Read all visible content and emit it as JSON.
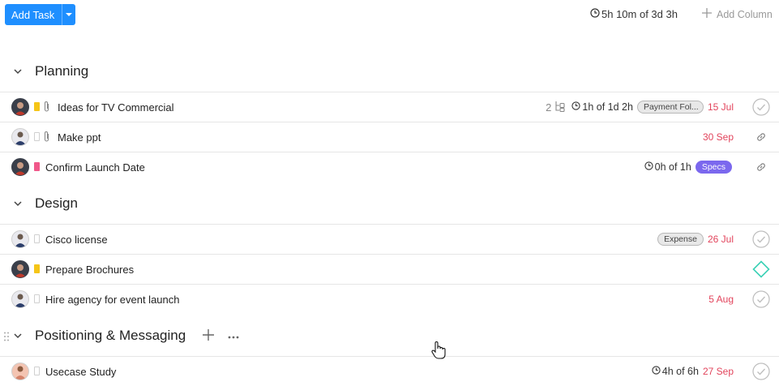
{
  "toolbar": {
    "add_task_label": "Add Task",
    "time_total": "5h 10m of 3d 3h",
    "add_column_label": "Add Column"
  },
  "sections": [
    {
      "title": "Planning",
      "tasks": [
        {
          "name": "Ideas for TV Commercial",
          "priority": "yellow",
          "attachment": true,
          "subtasks": "2",
          "estimate": "1h of 1d 2h",
          "tag": "Payment Fol...",
          "date": "15 Jul",
          "status": "check"
        },
        {
          "name": "Make ppt",
          "priority": "none",
          "attachment": true,
          "date": "30 Sep",
          "status": "link"
        },
        {
          "name": "Confirm Launch Date",
          "priority": "pink",
          "estimate": "0h of 1h",
          "tag": "Specs",
          "status": "link"
        }
      ]
    },
    {
      "title": "Design",
      "tasks": [
        {
          "name": "Cisco license",
          "priority": "none",
          "tag": "Expense",
          "date": "26 Jul",
          "status": "check"
        },
        {
          "name": "Prepare Brochures",
          "priority": "yellow",
          "status": "diamond"
        },
        {
          "name": "Hire agency for event launch",
          "priority": "none",
          "date": "5 Aug",
          "status": "check"
        }
      ]
    },
    {
      "title": "Positioning & Messaging",
      "tasks": [
        {
          "name": "Usecase Study",
          "priority": "none",
          "estimate": "4h of 6h",
          "date": "27 Sep",
          "status": "check"
        }
      ]
    }
  ],
  "colors": {
    "primary": "#1f8fff",
    "date_red": "#e2445c",
    "priority_yellow": "#f5c518",
    "priority_pink": "#f0588a",
    "tag_purple": "#7b68ee",
    "milestone_teal": "#3bd1b6"
  }
}
